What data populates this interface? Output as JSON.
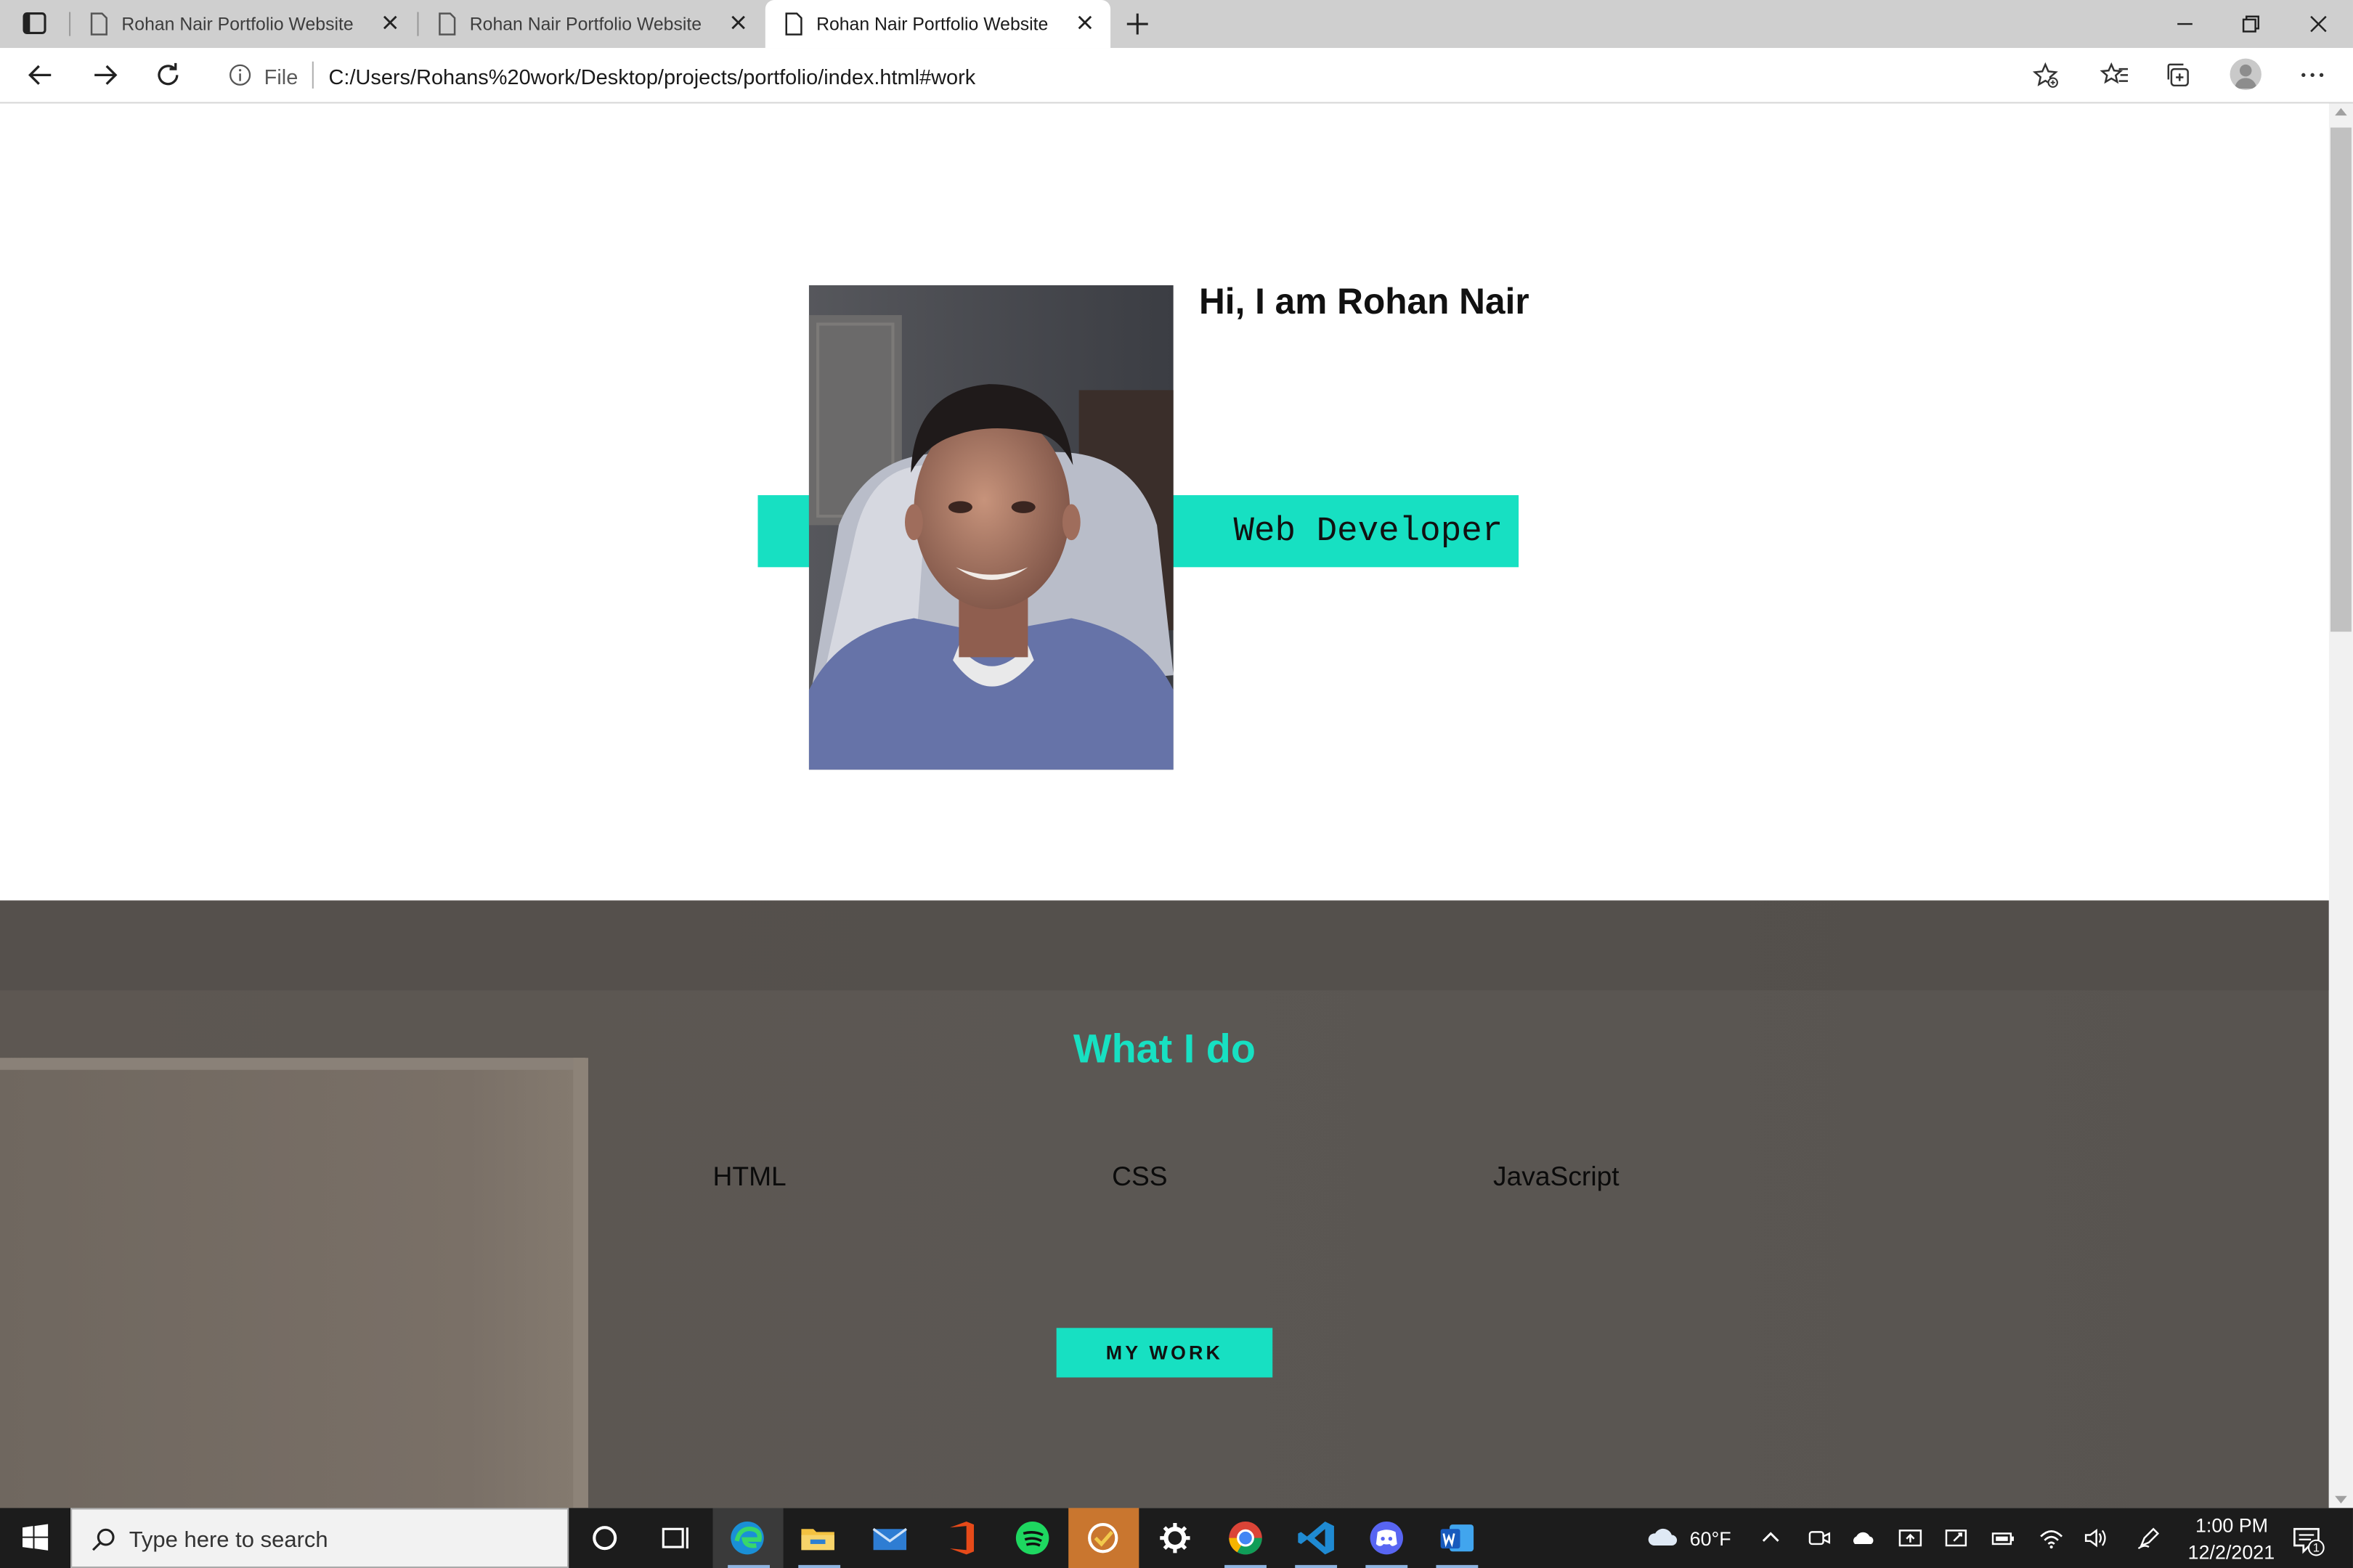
{
  "browser": {
    "tabs": [
      {
        "title": "Rohan Nair Portfolio Website"
      },
      {
        "title": "Rohan Nair Portfolio Website"
      },
      {
        "title": "Rohan Nair Portfolio Website"
      }
    ],
    "address": {
      "scheme_label": "File",
      "url": "C:/Users/Rohans%20work/Desktop/projects/portfolio/index.html#work"
    }
  },
  "page": {
    "hero": {
      "greeting": "Hi, I am Rohan Nair",
      "role": "Web Developer",
      "accent_color": "#17e0c2"
    },
    "services": {
      "title": "What I do",
      "skills": [
        "HTML",
        "CSS",
        "JavaScript"
      ],
      "button_label": "MY WORK"
    }
  },
  "taskbar": {
    "search_placeholder": "Type here to search",
    "weather": "60°F",
    "time": "1:00 PM",
    "date": "12/2/2021",
    "notification_count": "1",
    "apps": [
      "cortana",
      "task-view",
      "edge",
      "file-explorer",
      "mail",
      "office",
      "spotify",
      "todo",
      "settings",
      "chrome",
      "vscode",
      "discord",
      "word"
    ]
  }
}
